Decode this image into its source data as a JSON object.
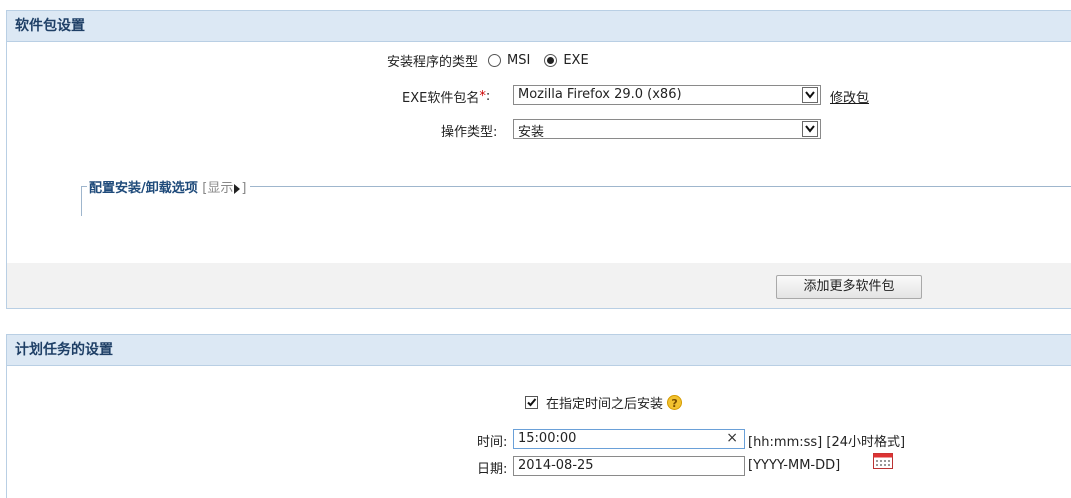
{
  "package_settings": {
    "title": "软件包设置",
    "installer_type_label": "安装程序的类型",
    "options": [
      "MSI",
      "EXE"
    ],
    "selected_option": "EXE",
    "exe_label": "EXE软件包名",
    "required_mark": "*",
    "colon": ":",
    "exe_value": "Mozilla Firefox 29.0 (x86)",
    "modify_link": "修改包",
    "operation_label": "操作类型:",
    "operation_value": "安装",
    "config_title": "配置安装/卸载选项",
    "config_toggle_open": "[",
    "config_toggle_text": "显示",
    "config_toggle_close": "]",
    "add_more_button": "添加更多软件包"
  },
  "schedule_settings": {
    "title": "计划任务的设置",
    "install_after_checked": true,
    "install_after_label": "在指定时间之后安装",
    "help_icon_text": "?",
    "time_label": "时间:",
    "time_value": "15:00:00",
    "time_clear": "×",
    "time_hint": "[hh:mm:ss] [24小时格式]",
    "date_label": "日期:",
    "date_value": "2014-08-25",
    "date_hint": "[YYYY-MM-DD]"
  }
}
